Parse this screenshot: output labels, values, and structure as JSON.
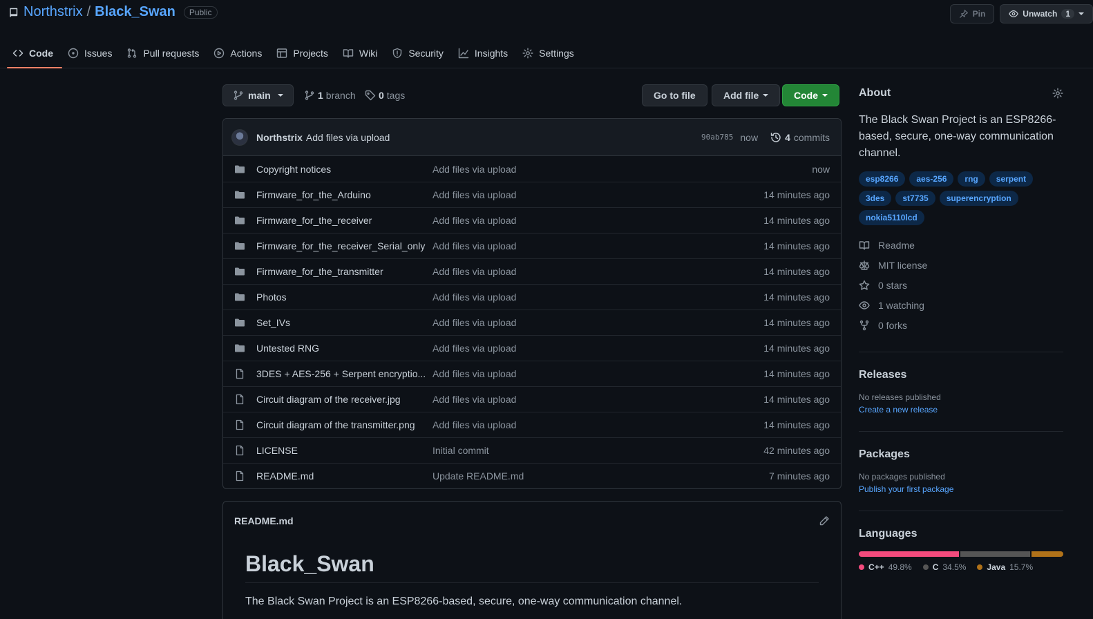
{
  "header": {
    "owner": "Northstrix",
    "separator": "/",
    "repo": "Black_Swan",
    "visibility": "Public",
    "pin_label": "Pin",
    "watch_label": "Unwatch",
    "watch_count": "1"
  },
  "tabs": [
    {
      "label": "Code",
      "icon": "code-icon"
    },
    {
      "label": "Issues",
      "icon": "issue-icon"
    },
    {
      "label": "Pull requests",
      "icon": "pull-request-icon"
    },
    {
      "label": "Actions",
      "icon": "play-icon"
    },
    {
      "label": "Projects",
      "icon": "table-icon"
    },
    {
      "label": "Wiki",
      "icon": "book-icon"
    },
    {
      "label": "Security",
      "icon": "shield-icon"
    },
    {
      "label": "Insights",
      "icon": "graph-icon"
    },
    {
      "label": "Settings",
      "icon": "gear-icon"
    }
  ],
  "toolbar": {
    "branch": "main",
    "branch_count": "1",
    "branch_label": "branch",
    "tag_count": "0",
    "tag_label": "tags",
    "go_to_file": "Go to file",
    "add_file": "Add file",
    "code": "Code"
  },
  "commit": {
    "author": "Northstrix",
    "message": "Add files via upload",
    "sha": "90ab785",
    "time": "now",
    "count": "4",
    "count_label": "commits"
  },
  "files": [
    {
      "type": "dir",
      "name": "Copyright notices",
      "message": "Add files via upload",
      "time": "now"
    },
    {
      "type": "dir",
      "name": "Firmware_for_the_Arduino",
      "message": "Add files via upload",
      "time": "14 minutes ago"
    },
    {
      "type": "dir",
      "name": "Firmware_for_the_receiver",
      "message": "Add files via upload",
      "time": "14 minutes ago"
    },
    {
      "type": "dir",
      "name": "Firmware_for_the_receiver_Serial_only",
      "message": "Add files via upload",
      "time": "14 minutes ago"
    },
    {
      "type": "dir",
      "name": "Firmware_for_the_transmitter",
      "message": "Add files via upload",
      "time": "14 minutes ago"
    },
    {
      "type": "dir",
      "name": "Photos",
      "message": "Add files via upload",
      "time": "14 minutes ago"
    },
    {
      "type": "dir",
      "name": "Set_IVs",
      "message": "Add files via upload",
      "time": "14 minutes ago"
    },
    {
      "type": "dir",
      "name": "Untested RNG",
      "message": "Add files via upload",
      "time": "14 minutes ago"
    },
    {
      "type": "file",
      "name": "3DES + AES-256 + Serpent encryptio...",
      "message": "Add files via upload",
      "time": "14 minutes ago"
    },
    {
      "type": "file",
      "name": "Circuit diagram of the receiver.jpg",
      "message": "Add files via upload",
      "time": "14 minutes ago"
    },
    {
      "type": "file",
      "name": "Circuit diagram of the transmitter.png",
      "message": "Add files via upload",
      "time": "14 minutes ago"
    },
    {
      "type": "file",
      "name": "LICENSE",
      "message": "Initial commit",
      "time": "42 minutes ago"
    },
    {
      "type": "file",
      "name": "README.md",
      "message": "Update README.md",
      "time": "7 minutes ago"
    }
  ],
  "readme": {
    "filename": "README.md",
    "heading": "Black_Swan",
    "text": "The Black Swan Project is an ESP8266-based, secure, one-way communication channel."
  },
  "about": {
    "title": "About",
    "description": "The Black Swan Project is an ESP8266-based, secure, one-way communication channel.",
    "topics": [
      "esp8266",
      "aes-256",
      "rng",
      "serpent",
      "3des",
      "st7735",
      "superencryption",
      "nokia5110lcd"
    ],
    "links": [
      {
        "label": "Readme",
        "icon": "book-icon"
      },
      {
        "label": "MIT license",
        "icon": "law-icon"
      },
      {
        "label": "0 stars",
        "icon": "star-icon"
      },
      {
        "label": "1 watching",
        "icon": "eye-icon"
      },
      {
        "label": "0 forks",
        "icon": "fork-icon"
      }
    ]
  },
  "releases": {
    "title": "Releases",
    "empty": "No releases published",
    "link": "Create a new release"
  },
  "packages": {
    "title": "Packages",
    "empty": "No packages published",
    "link": "Publish your first package"
  },
  "languages": {
    "title": "Languages",
    "items": [
      {
        "name": "C++",
        "percent": "49.8%",
        "value": 49.8,
        "color": "#f34b7d"
      },
      {
        "name": "C",
        "percent": "34.5%",
        "value": 34.5,
        "color": "#555555"
      },
      {
        "name": "Java",
        "percent": "15.7%",
        "value": 15.7,
        "color": "#b07219"
      }
    ]
  }
}
